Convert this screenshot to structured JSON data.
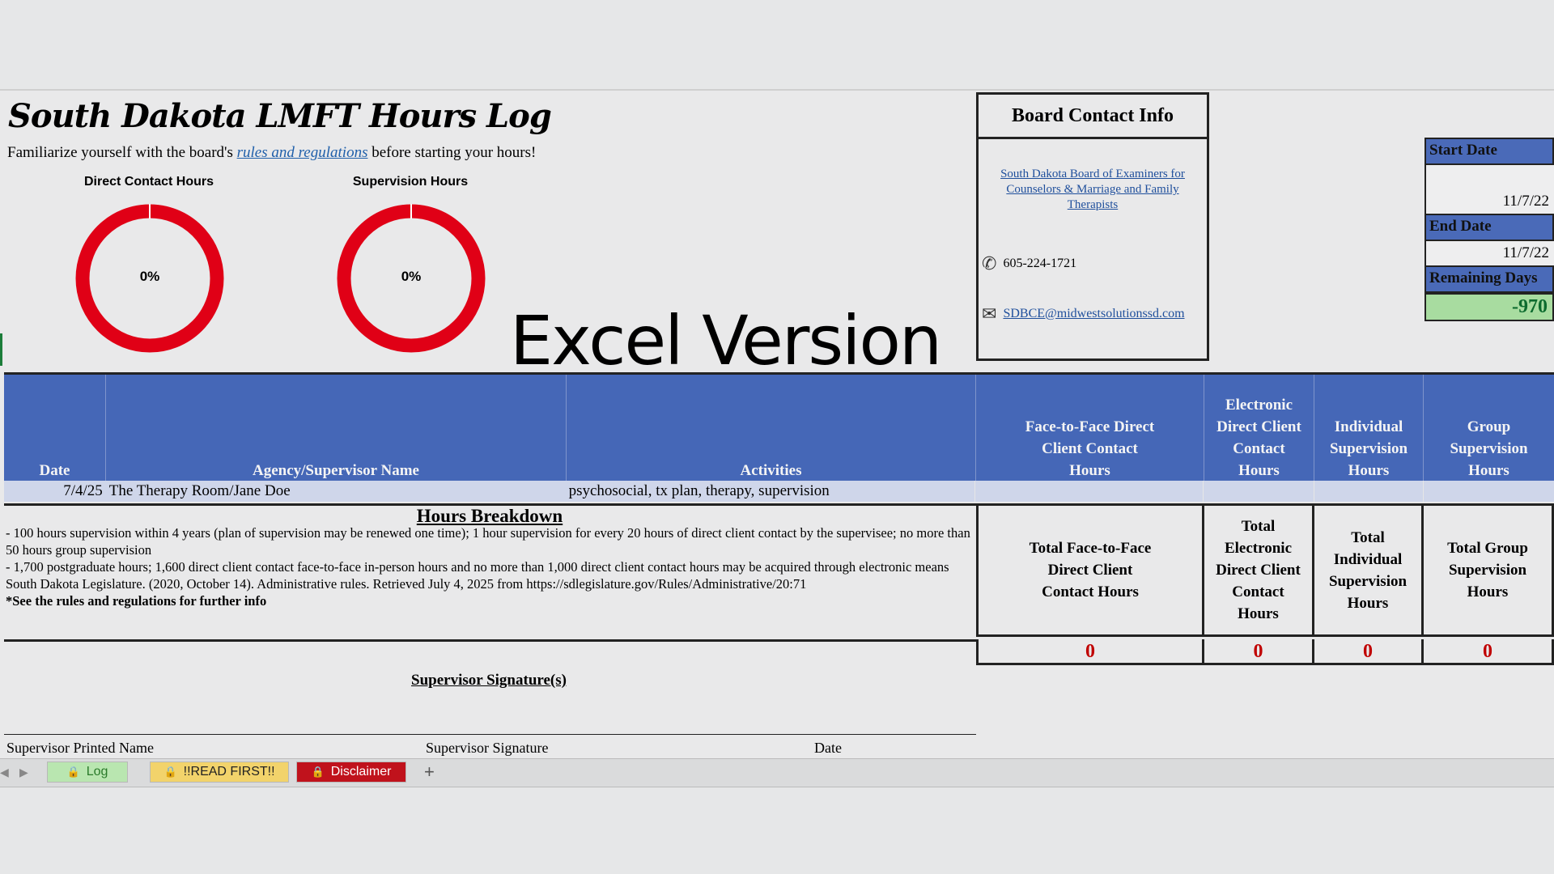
{
  "title": "South Dakota LMFT Hours Log",
  "intro": {
    "before": "Familiarize yourself with the board's ",
    "link": "rules and regulations",
    "after": " before starting your hours!"
  },
  "gauges": [
    {
      "label": "Direct Contact Hours",
      "percent_text": "0%",
      "percent": 0
    },
    {
      "label": "Supervision Hours",
      "percent_text": "0%",
      "percent": 0
    }
  ],
  "overlay_text": "Excel Version",
  "board": {
    "title": "Board Contact Info",
    "org_link": "South Dakota Board of Examiners for Counselors & Marriage and Family Therapists",
    "phone": "605-224-1721",
    "email": "SDBCE@midwestsolutionssd.com",
    "phone_icon": "phone-icon",
    "email_icon": "mail-icon"
  },
  "dates": {
    "start_label": "Start Date",
    "start_value": "11/7/22",
    "end_label": "End Date",
    "end_value": "11/7/22",
    "remaining_label": "Remaining Days",
    "remaining_value": "-970"
  },
  "table": {
    "headers": [
      "Date",
      "Agency/Supervisor Name",
      "Activities",
      "Face-to-Face Direct Client Contact Hours",
      "Electronic Direct Client Contact Hours",
      "Individual Supervision Hours",
      "Group Supervision Hours"
    ],
    "row": [
      "7/4/25",
      "The Therapy Room/Jane Doe",
      "psychosocial, tx plan, therapy, supervision",
      "",
      "",
      "",
      ""
    ]
  },
  "breakdown": {
    "title": "Hours Breakdown",
    "lines": [
      "- 100 hours supervision within 4 years (plan of supervision may be renewed one time); 1 hour supervision for every 20 hours of direct client contact by the supervisee; no more than 50 hours group supervision",
      "- 1,700 postgraduate hours; 1,600 direct client contact face-to-face in-person hours and no more than 1,000 direct client contact hours may be acquired through electronic means",
      "South Dakota Legislature. (2020, October 14). Administrative rules. Retrieved July 4, 2025 from https://sdlegislature.gov/Rules/Administrative/20:71",
      "*See the rules and regulations for further info"
    ]
  },
  "totals": {
    "labels": [
      "Total Face-to-Face Direct Client Contact Hours",
      "Total Electronic Direct Client Contact Hours",
      "Total Individual Supervision Hours",
      "Total Group Supervision Hours"
    ],
    "values": [
      "0",
      "0",
      "0",
      "0"
    ]
  },
  "signature": {
    "title": "Supervisor Signature(s)",
    "printed_name": "Supervisor Printed Name",
    "signature": "Supervisor Signature",
    "date": "Date"
  },
  "tabs": [
    {
      "label": "Log",
      "color": "#b9e6b0",
      "text_color": "#2a7a2a"
    },
    {
      "label": "!!READ FIRST!!",
      "color": "#f2d36b",
      "text_color": "#222"
    },
    {
      "label": "Disclaimer",
      "color": "#c0121c",
      "text_color": "#ffffff"
    }
  ],
  "colors": {
    "header_blue": "#4567b7",
    "gauge_red": "#e00016",
    "total_red": "#c00000",
    "remaining_green": "#a8dca0"
  }
}
